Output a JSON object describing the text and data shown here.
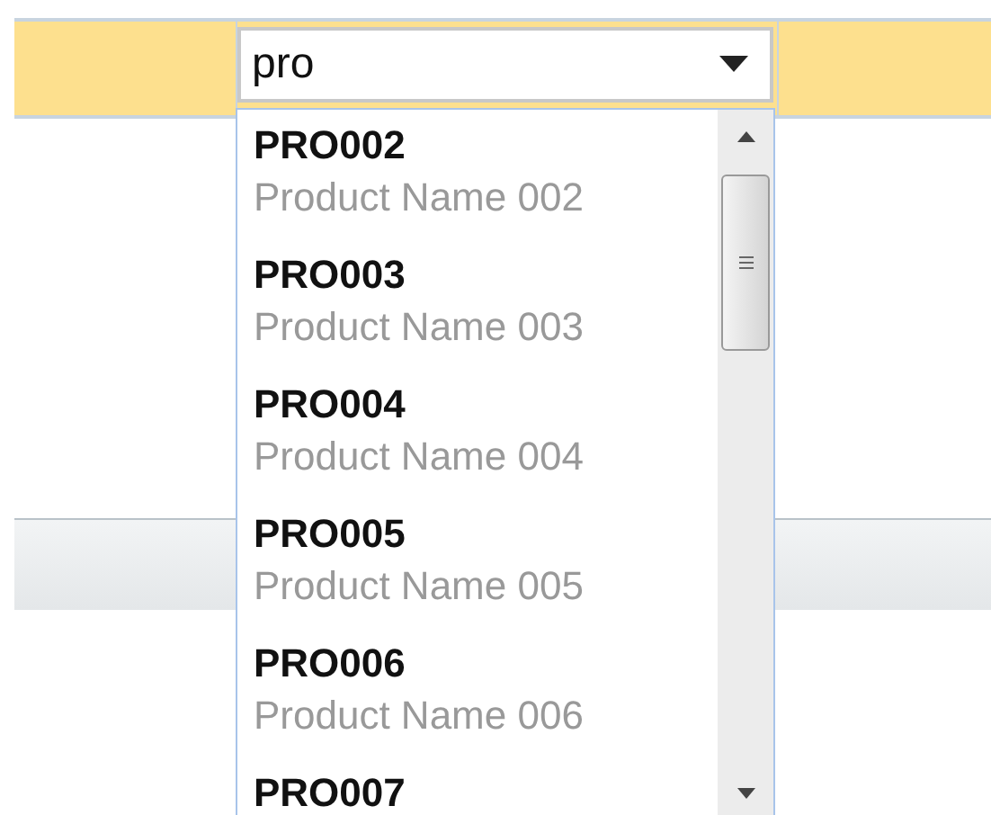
{
  "combo": {
    "value": "pro"
  },
  "options": [
    {
      "code": "PRO002",
      "name": "Product Name 002",
      "selected": false
    },
    {
      "code": "PRO003",
      "name": "Product Name 003",
      "selected": false
    },
    {
      "code": "PRO004",
      "name": "Product Name 004",
      "selected": false
    },
    {
      "code": "PRO005",
      "name": "Product Name 005",
      "selected": false
    },
    {
      "code": "PRO006",
      "name": "Product Name 006",
      "selected": false
    },
    {
      "code": "PRO007",
      "selected": false
    }
  ]
}
